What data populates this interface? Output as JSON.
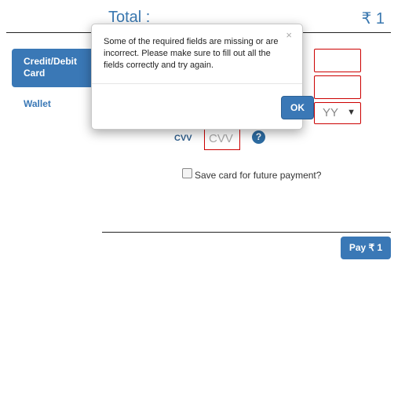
{
  "header": {
    "total_label": "Total :",
    "total_value": "₹ 1"
  },
  "sidebar": {
    "items": [
      {
        "label": "Credit/Debit Card",
        "active": true
      },
      {
        "label": "Wallet",
        "active": false
      }
    ]
  },
  "form": {
    "expiry_year_placeholder": "YY",
    "cvv_label": "CVV",
    "cvv_placeholder": "CVV",
    "help_icon": "question-circle-icon",
    "save_card_label": "Save card for future payment?",
    "save_card_checked": false
  },
  "pay_button_label": "Pay ₹ 1",
  "dialog": {
    "message": "Some of the required fields are missing or are incorrect. Please make sure to fill out all the fields correctly and try again.",
    "close_glyph": "×",
    "ok_label": "OK"
  },
  "colors": {
    "accent": "#3a78b6",
    "error_border": "#cc0000",
    "text_dark": "#222222"
  }
}
